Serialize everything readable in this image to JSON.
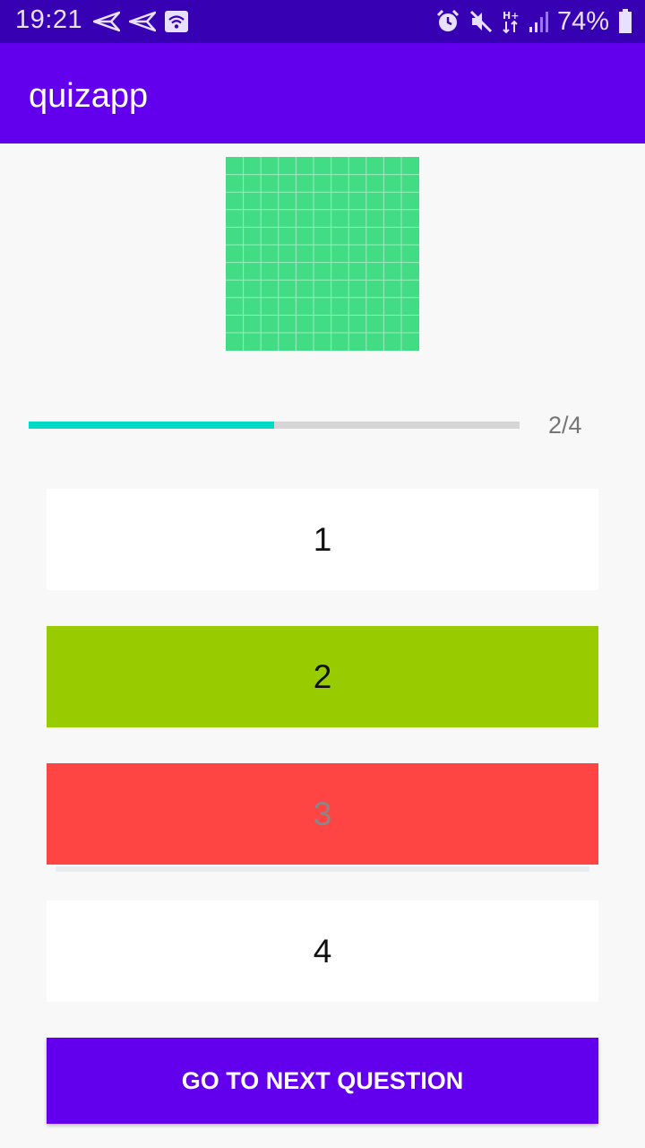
{
  "status_bar": {
    "time": "19:21",
    "battery": "74%",
    "icons": [
      "send-icon",
      "send-icon",
      "wifi-icon",
      "alarm-icon",
      "mute-icon",
      "data-hplus-icon",
      "signal-icon",
      "battery-icon"
    ]
  },
  "app_bar": {
    "title": "quizapp"
  },
  "question": {
    "image_icon": "grid-image",
    "image_color": "#41dc84"
  },
  "progress": {
    "current": 2,
    "total": 4,
    "label": "2/4",
    "fraction": 0.5
  },
  "options": [
    {
      "label": "1",
      "state": "default",
      "bg": "#ffffff",
      "fg": "#111111"
    },
    {
      "label": "2",
      "state": "correct",
      "bg": "#99cc00",
      "fg": "#111111"
    },
    {
      "label": "3",
      "state": "wrong",
      "bg": "#ff4444",
      "fg": "#888888"
    },
    {
      "label": "4",
      "state": "default",
      "bg": "#ffffff",
      "fg": "#111111"
    }
  ],
  "next_button": {
    "label": "GO TO NEXT QUESTION",
    "bg": "#6200ee"
  },
  "colors": {
    "status_bar": "#3700b3",
    "app_bar": "#6200ee",
    "progress_fill": "#03dac5",
    "progress_track": "#d6d6d6"
  }
}
